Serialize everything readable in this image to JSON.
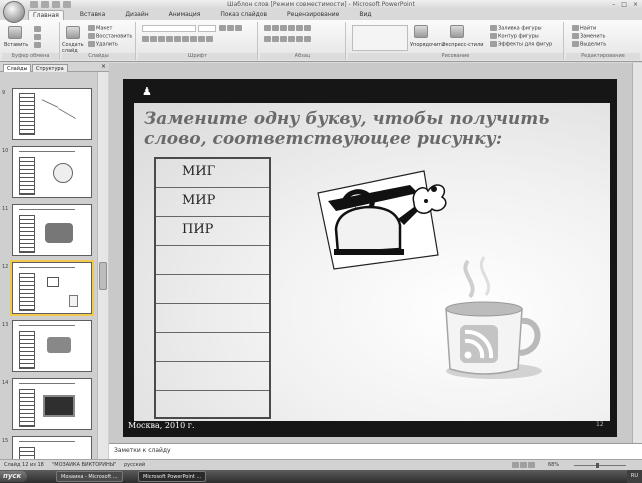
{
  "window": {
    "title": "Шаблон слов [Режим совместимости] - Microsoft PowerPoint",
    "min": "–",
    "max": "□",
    "close": "×"
  },
  "ribbon_tabs": [
    "Главная",
    "Вставка",
    "Дизайн",
    "Анимация",
    "Показ слайдов",
    "Рецензирование",
    "Вид"
  ],
  "ribbon": {
    "clipboard": {
      "paste": "Вставить",
      "group": "Буфер обмена"
    },
    "slides": {
      "new_slide": "Создать слайд",
      "layout": "Макет",
      "reset": "Восстановить",
      "delete": "Удалить",
      "group": "Слайды"
    },
    "font": {
      "group": "Шрифт"
    },
    "paragraph": {
      "group": "Абзац"
    },
    "drawing": {
      "arrange": "Упорядочить",
      "quick_styles": "Экспресс-стили",
      "fill": "Заливка фигуры",
      "outline": "Контур фигуры",
      "effects": "Эффекты для фигур",
      "group": "Рисование"
    },
    "editing": {
      "find": "Найти",
      "replace": "Заменить",
      "select": "Выделить",
      "group": "Редактирование"
    }
  },
  "pane": {
    "tab_slides": "Слайды",
    "tab_outline": "Структура",
    "close": "×"
  },
  "thumbnails": [
    {
      "number": "9",
      "selected": false
    },
    {
      "number": "10",
      "selected": false
    },
    {
      "number": "11",
      "selected": false
    },
    {
      "number": "12",
      "selected": true
    },
    {
      "number": "13",
      "selected": false
    },
    {
      "number": "14",
      "selected": false
    },
    {
      "number": "15",
      "selected": false
    }
  ],
  "slide": {
    "heading": "Замените одну букву, чтобы получить слово, соответствующее рисунку:",
    "words": [
      "МИГ",
      "МИР",
      "ПИР",
      "",
      "",
      "",
      "",
      "",
      ""
    ],
    "footer": "Москва, 2010 г.",
    "number": "12"
  },
  "notes_placeholder": "Заметки к слайду",
  "status": {
    "slide_info": "Слайд 12 из 18",
    "theme": "\"МОЗАИКА ВИКТОРИНЫ\"",
    "language": "русский",
    "zoom": "68%",
    "zoom_level": 0.45
  },
  "taskbar": {
    "start": "пуск",
    "tasks": [
      "Мозаика - Microsoft ...",
      "Microsoft PowerPoint ..."
    ],
    "tray": "RU"
  }
}
